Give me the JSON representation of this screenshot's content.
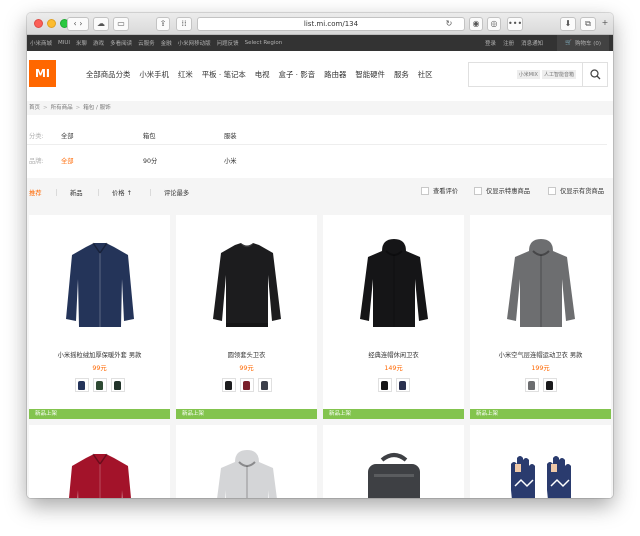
{
  "browser": {
    "url": "list.mi.com/134"
  },
  "topnav": {
    "left_links": [
      "小米商城",
      "MIUI",
      "米聊",
      "游戏",
      "多看阅读",
      "云服务",
      "金融",
      "小米网移动版",
      "问题反馈",
      "Select Region"
    ],
    "right_links": [
      "登录",
      "注册",
      "消息通知"
    ],
    "cart_label": "购物车 (0)"
  },
  "header": {
    "logo": "MI",
    "nav_items": [
      "全部商品分类",
      "小米手机",
      "红米",
      "平板 · 笔记本",
      "电视",
      "盒子 · 影音",
      "路由器",
      "智能硬件",
      "服务",
      "社区"
    ],
    "search_tags": [
      "小米MIX",
      "人工智能音箱"
    ]
  },
  "breadcrumb": [
    "首页",
    "所有商品",
    "箱包 / 服饰"
  ],
  "filter": {
    "row1": {
      "label": "分类:",
      "options": [
        "全部",
        "箱包",
        "服装"
      ]
    },
    "row2": {
      "label": "品牌:",
      "options": [
        "全部",
        "90分",
        "小米"
      ],
      "active_index": 0
    }
  },
  "sort": {
    "options": [
      "推荐",
      "新品",
      "价格 ↑",
      "评论最多"
    ],
    "active_index": 0,
    "checkboxes": [
      "查看评价",
      "仅显示特惠商品",
      "仅显示有货商品"
    ]
  },
  "products": [
    {
      "name": "小米摇粒绒加厚保暖外套 男款",
      "price": "99元",
      "badge": "新品上架",
      "garment": "jacket",
      "color": "#243459",
      "variants": [
        "#24345a",
        "#2e4a33",
        "#22332a"
      ]
    },
    {
      "name": "圆领套头卫衣",
      "price": "99元",
      "badge": "新品上架",
      "garment": "sweatshirt",
      "color": "#1c1c1e",
      "variants": [
        "#1d1d1f",
        "#7a1f2b",
        "#3b3f4a"
      ]
    },
    {
      "name": "经典连帽休闲卫衣",
      "price": "149元",
      "badge": "新品上架",
      "garment": "hoodie",
      "color": "#151517",
      "variants": [
        "#141416",
        "#2b3150"
      ]
    },
    {
      "name": "小米空气层连帽运动卫衣 男款",
      "price": "199元",
      "badge": "新品上架",
      "garment": "hoodie",
      "color": "#6d6e70",
      "variants": [
        "#6c6d6f",
        "#1a1a1c"
      ]
    },
    {
      "garment": "jacket",
      "color": "#a3132a"
    },
    {
      "garment": "hoodie",
      "color": "#d4d5d7"
    },
    {
      "garment": "bag",
      "color": "#3e4044"
    },
    {
      "garment": "gloves",
      "color": "#2a3b6e"
    }
  ],
  "colors": {
    "accent": "#ff6700",
    "badge": "#83c44e",
    "topnav": "#333333"
  }
}
